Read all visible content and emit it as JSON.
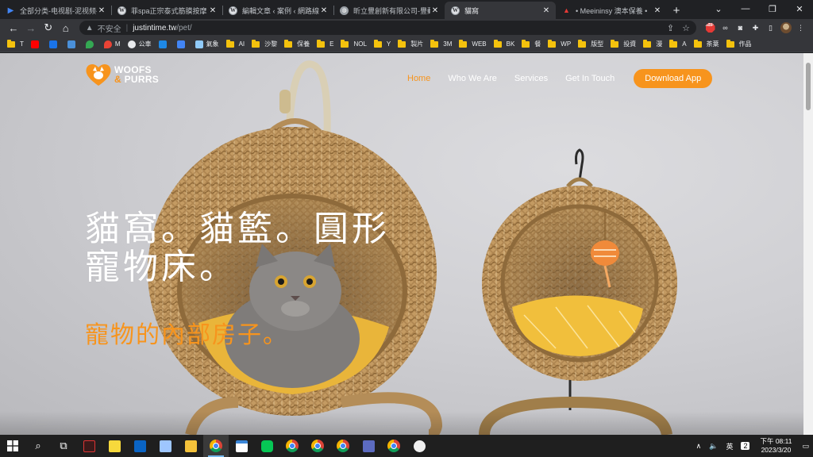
{
  "browser": {
    "tabs": [
      {
        "title": "全部分类-电视剧-泥视频-泥",
        "favicon": "play-icon"
      },
      {
        "title": "菲spa正宗泰式筋膜按摩（",
        "favicon": "wordpress-icon"
      },
      {
        "title": "編輯文章 ‹ 案例 ‹ 網路線上",
        "favicon": "wordpress-icon"
      },
      {
        "title": "昕立豐創新有限公司-豐動",
        "favicon": "globe-icon"
      },
      {
        "title": "貓窩",
        "favicon": "wordpress-icon",
        "active": true
      },
      {
        "title": "• Meeininsy 澳本保養 •",
        "favicon": "chart-icon"
      }
    ],
    "toolbar": {
      "security_label": "不安全",
      "url_host": "justintime.tw",
      "url_path": "/pet/"
    },
    "bookmarks": [
      {
        "label": "T",
        "type": "folder"
      },
      {
        "label": "",
        "type": "youtube"
      },
      {
        "label": "",
        "type": "site"
      },
      {
        "label": "",
        "type": "site"
      },
      {
        "label": "",
        "type": "maps"
      },
      {
        "label": "M",
        "type": "maps"
      },
      {
        "label": "公車",
        "type": "site"
      },
      {
        "label": "",
        "type": "site"
      },
      {
        "label": "",
        "type": "site"
      },
      {
        "label": "氣象",
        "type": "site"
      },
      {
        "label": "AI",
        "type": "folder"
      },
      {
        "label": "沙黎",
        "type": "folder"
      },
      {
        "label": "保養",
        "type": "folder"
      },
      {
        "label": "E",
        "type": "folder"
      },
      {
        "label": "NOL",
        "type": "folder"
      },
      {
        "label": "Y",
        "type": "folder"
      },
      {
        "label": "製片",
        "type": "folder"
      },
      {
        "label": "3M",
        "type": "folder"
      },
      {
        "label": "WEB",
        "type": "folder"
      },
      {
        "label": "BK",
        "type": "folder"
      },
      {
        "label": "餐",
        "type": "folder"
      },
      {
        "label": "WP",
        "type": "folder"
      },
      {
        "label": "版型",
        "type": "folder"
      },
      {
        "label": "投資",
        "type": "folder"
      },
      {
        "label": "漫",
        "type": "folder"
      },
      {
        "label": "A",
        "type": "folder"
      },
      {
        "label": "茶葉",
        "type": "folder"
      },
      {
        "label": "作品",
        "type": "folder"
      }
    ]
  },
  "site": {
    "logo": {
      "line1": "WOOFS",
      "amp": "&",
      "line2": "PURRS"
    },
    "nav": [
      {
        "label": "Home",
        "active": true
      },
      {
        "label": "Who We Are"
      },
      {
        "label": "Services"
      },
      {
        "label": "Get In Touch"
      }
    ],
    "cta_label": "Download App",
    "hero_title": "貓窩。貓籃。圓形寵物床。",
    "hero_subtitle": "寵物的內部房子。"
  },
  "taskbar": {
    "clock_time": "下午 08:11",
    "clock_date": "2023/3/20",
    "notification_count": "2"
  },
  "colors": {
    "accent": "#f7941d",
    "chrome_bg": "#202124",
    "toolbar_bg": "#35363a"
  }
}
